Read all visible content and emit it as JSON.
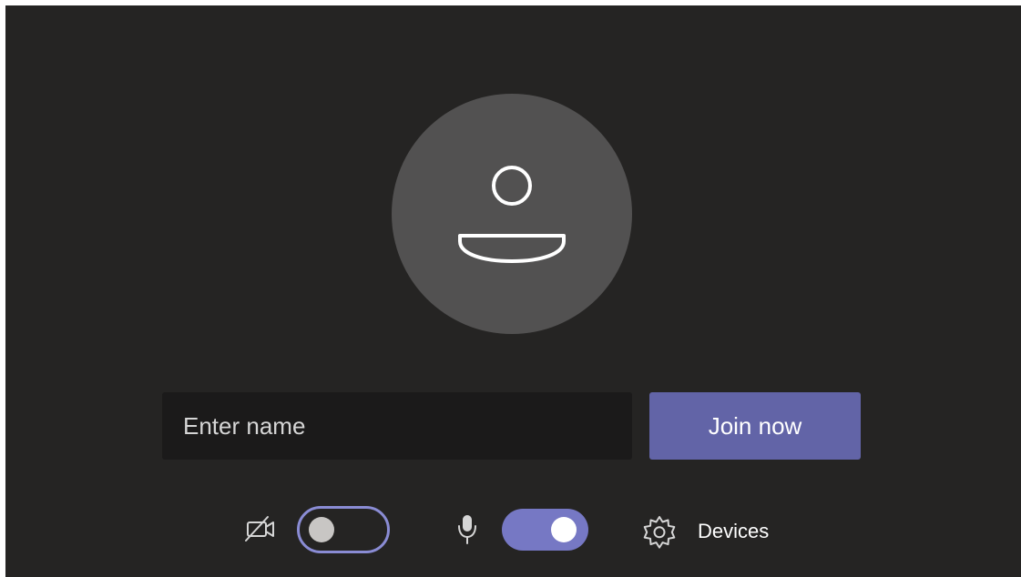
{
  "join_form": {
    "name_placeholder": "Enter name",
    "name_value": "",
    "join_label": "Join now"
  },
  "controls": {
    "camera": {
      "icon": "video-off-icon",
      "toggle_state": "off"
    },
    "microphone": {
      "icon": "microphone-icon",
      "toggle_state": "on"
    },
    "devices": {
      "icon": "gear-icon",
      "label": "Devices"
    }
  },
  "colors": {
    "background": "#252423",
    "avatar_circle": "#525151",
    "input_background": "#1b1a1a",
    "accent": "#6264a7",
    "toggle_on": "#7678c4",
    "toggle_outline": "#8a8cd4"
  }
}
